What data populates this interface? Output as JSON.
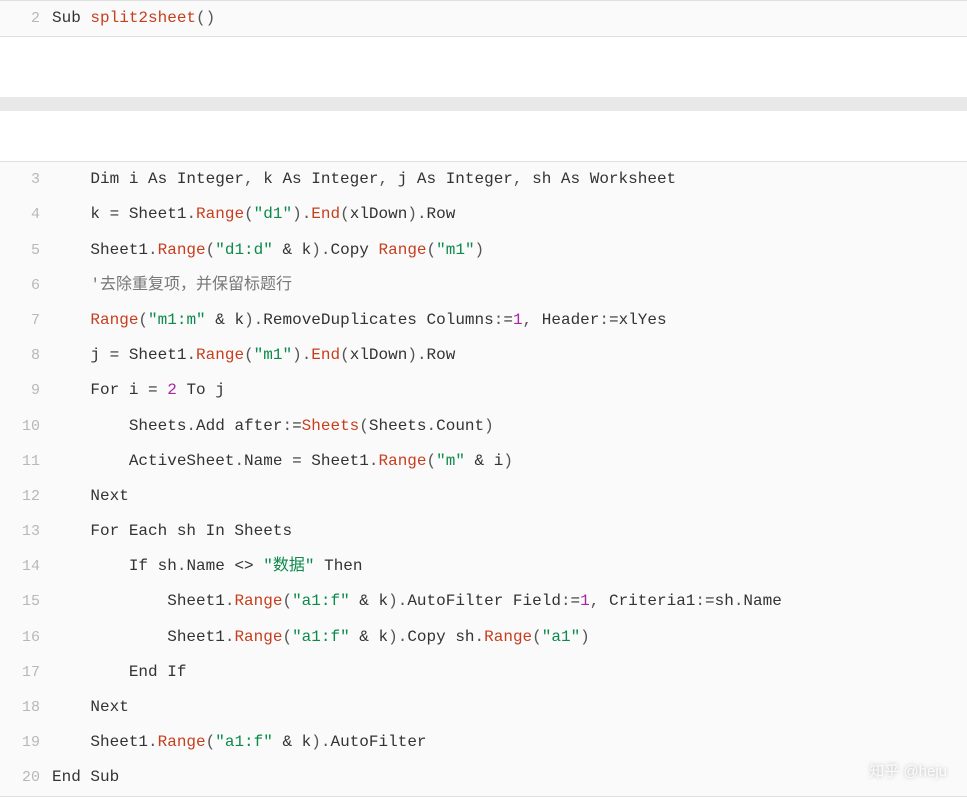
{
  "watermark": "知乎 @heju",
  "block1": {
    "start": 2,
    "lines": [
      {
        "num": 2,
        "tokens": [
          [
            "kw",
            "Sub "
          ],
          [
            "fn",
            "split2sheet"
          ],
          [
            "paren",
            "("
          ],
          [
            "paren",
            ")"
          ]
        ]
      }
    ]
  },
  "block2": {
    "start": 3,
    "lines": [
      {
        "num": 3,
        "tokens": [
          [
            "",
            "    Dim i As Integer"
          ],
          [
            "paren",
            ","
          ],
          [
            "",
            " k As Integer"
          ],
          [
            "paren",
            ","
          ],
          [
            "",
            " j As Integer"
          ],
          [
            "paren",
            ","
          ],
          [
            "",
            " sh As Worksheet"
          ]
        ]
      },
      {
        "num": 4,
        "tokens": [
          [
            "",
            "    k "
          ],
          [
            "op",
            "="
          ],
          [
            "",
            " Sheet1"
          ],
          [
            "paren",
            "."
          ],
          [
            "fn",
            "Range"
          ],
          [
            "paren",
            "("
          ],
          [
            "str",
            "\"d1\""
          ],
          [
            "paren",
            ")"
          ],
          [
            "paren",
            "."
          ],
          [
            "fn",
            "End"
          ],
          [
            "paren",
            "("
          ],
          [
            "",
            "xlDown"
          ],
          [
            "paren",
            ")"
          ],
          [
            "paren",
            "."
          ],
          [
            "",
            "Row"
          ]
        ]
      },
      {
        "num": 5,
        "tokens": [
          [
            "",
            "    Sheet1"
          ],
          [
            "paren",
            "."
          ],
          [
            "fn",
            "Range"
          ],
          [
            "paren",
            "("
          ],
          [
            "str",
            "\"d1:d\" "
          ],
          [
            "op",
            "&"
          ],
          [
            "",
            " k"
          ],
          [
            "paren",
            ")"
          ],
          [
            "paren",
            "."
          ],
          [
            "",
            "Copy "
          ],
          [
            "fn",
            "Range"
          ],
          [
            "paren",
            "("
          ],
          [
            "str",
            "\"m1\""
          ],
          [
            "paren",
            ")"
          ]
        ]
      },
      {
        "num": 6,
        "tokens": [
          [
            "comment",
            "    '去除重复项，并保留标题行"
          ]
        ]
      },
      {
        "num": 7,
        "tokens": [
          [
            "",
            "    "
          ],
          [
            "fn",
            "Range"
          ],
          [
            "paren",
            "("
          ],
          [
            "str",
            "\"m1:m\" "
          ],
          [
            "op",
            "&"
          ],
          [
            "",
            " k"
          ],
          [
            "paren",
            ")"
          ],
          [
            "paren",
            "."
          ],
          [
            "",
            "RemoveDuplicates Columns"
          ],
          [
            "paren",
            ":"
          ],
          [
            "op",
            "="
          ],
          [
            "num",
            "1"
          ],
          [
            "paren",
            ","
          ],
          [
            "",
            " Header"
          ],
          [
            "paren",
            ":"
          ],
          [
            "op",
            "="
          ],
          [
            "",
            "xlYes"
          ]
        ]
      },
      {
        "num": 8,
        "tokens": [
          [
            "",
            "    j "
          ],
          [
            "op",
            "="
          ],
          [
            "",
            " Sheet1"
          ],
          [
            "paren",
            "."
          ],
          [
            "fn",
            "Range"
          ],
          [
            "paren",
            "("
          ],
          [
            "str",
            "\"m1\""
          ],
          [
            "paren",
            ")"
          ],
          [
            "paren",
            "."
          ],
          [
            "fn",
            "End"
          ],
          [
            "paren",
            "("
          ],
          [
            "",
            "xlDown"
          ],
          [
            "paren",
            ")"
          ],
          [
            "paren",
            "."
          ],
          [
            "",
            "Row"
          ]
        ]
      },
      {
        "num": 9,
        "tokens": [
          [
            "",
            "    For i "
          ],
          [
            "op",
            "="
          ],
          [
            "",
            " "
          ],
          [
            "num",
            "2"
          ],
          [
            "",
            " To j"
          ]
        ]
      },
      {
        "num": 10,
        "tokens": [
          [
            "",
            "        Sheets"
          ],
          [
            "paren",
            "."
          ],
          [
            "",
            "Add after"
          ],
          [
            "paren",
            ":"
          ],
          [
            "op",
            "="
          ],
          [
            "fn",
            "Sheets"
          ],
          [
            "paren",
            "("
          ],
          [
            "",
            "Sheets"
          ],
          [
            "paren",
            "."
          ],
          [
            "",
            "Count"
          ],
          [
            "paren",
            ")"
          ]
        ]
      },
      {
        "num": 11,
        "tokens": [
          [
            "",
            "        ActiveSheet"
          ],
          [
            "paren",
            "."
          ],
          [
            "",
            "Name "
          ],
          [
            "op",
            "="
          ],
          [
            "",
            " Sheet1"
          ],
          [
            "paren",
            "."
          ],
          [
            "fn",
            "Range"
          ],
          [
            "paren",
            "("
          ],
          [
            "str",
            "\"m\" "
          ],
          [
            "op",
            "&"
          ],
          [
            "",
            " i"
          ],
          [
            "paren",
            ")"
          ]
        ]
      },
      {
        "num": 12,
        "tokens": [
          [
            "",
            "    Next"
          ]
        ]
      },
      {
        "num": 13,
        "tokens": [
          [
            "",
            "    For Each sh In Sheets"
          ]
        ]
      },
      {
        "num": 14,
        "tokens": [
          [
            "",
            "        If sh"
          ],
          [
            "paren",
            "."
          ],
          [
            "",
            "Name "
          ],
          [
            "op",
            "<>"
          ],
          [
            "",
            " "
          ],
          [
            "str",
            "\"数据\""
          ],
          [
            "",
            " Then"
          ]
        ]
      },
      {
        "num": 15,
        "tokens": [
          [
            "",
            "            Sheet1"
          ],
          [
            "paren",
            "."
          ],
          [
            "fn",
            "Range"
          ],
          [
            "paren",
            "("
          ],
          [
            "str",
            "\"a1:f\" "
          ],
          [
            "op",
            "&"
          ],
          [
            "",
            " k"
          ],
          [
            "paren",
            ")"
          ],
          [
            "paren",
            "."
          ],
          [
            "",
            "AutoFilter Field"
          ],
          [
            "paren",
            ":"
          ],
          [
            "op",
            "="
          ],
          [
            "num",
            "1"
          ],
          [
            "paren",
            ","
          ],
          [
            "",
            " Criteria1"
          ],
          [
            "paren",
            ":"
          ],
          [
            "op",
            "="
          ],
          [
            "",
            "sh"
          ],
          [
            "paren",
            "."
          ],
          [
            "",
            "Name"
          ]
        ]
      },
      {
        "num": 16,
        "tokens": [
          [
            "",
            "            Sheet1"
          ],
          [
            "paren",
            "."
          ],
          [
            "fn",
            "Range"
          ],
          [
            "paren",
            "("
          ],
          [
            "str",
            "\"a1:f\" "
          ],
          [
            "op",
            "&"
          ],
          [
            "",
            " k"
          ],
          [
            "paren",
            ")"
          ],
          [
            "paren",
            "."
          ],
          [
            "",
            "Copy sh"
          ],
          [
            "paren",
            "."
          ],
          [
            "fn",
            "Range"
          ],
          [
            "paren",
            "("
          ],
          [
            "str",
            "\"a1\""
          ],
          [
            "paren",
            ")"
          ]
        ]
      },
      {
        "num": 17,
        "tokens": [
          [
            "",
            "        End If"
          ]
        ]
      },
      {
        "num": 18,
        "tokens": [
          [
            "",
            "    Next"
          ]
        ]
      },
      {
        "num": 19,
        "tokens": [
          [
            "",
            "    Sheet1"
          ],
          [
            "paren",
            "."
          ],
          [
            "fn",
            "Range"
          ],
          [
            "paren",
            "("
          ],
          [
            "str",
            "\"a1:f\" "
          ],
          [
            "op",
            "&"
          ],
          [
            "",
            " k"
          ],
          [
            "paren",
            ")"
          ],
          [
            "paren",
            "."
          ],
          [
            "",
            "AutoFilter"
          ]
        ]
      },
      {
        "num": 20,
        "tokens": [
          [
            "",
            "End Sub"
          ]
        ]
      }
    ]
  }
}
